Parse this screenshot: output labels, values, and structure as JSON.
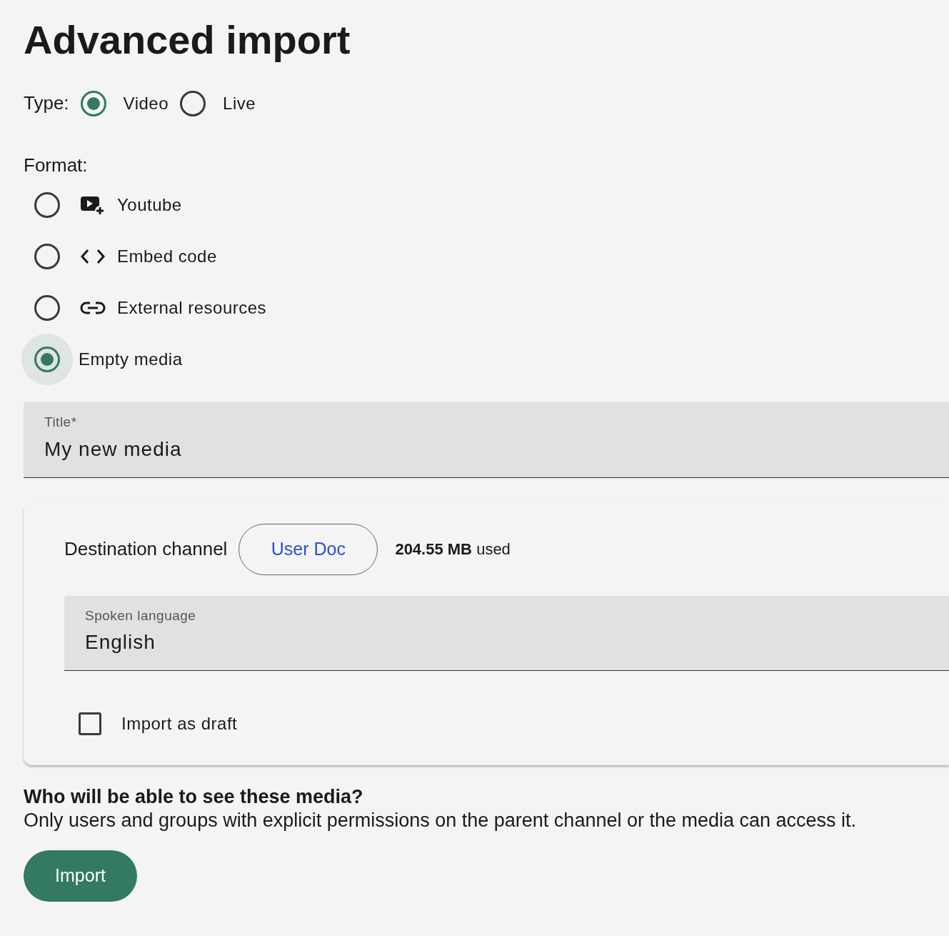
{
  "page": {
    "title": "Advanced import"
  },
  "type": {
    "label": "Type:",
    "options": [
      {
        "label": "Video",
        "selected": true
      },
      {
        "label": "Live",
        "selected": false
      }
    ]
  },
  "format": {
    "label": "Format:",
    "options": [
      {
        "kind": "youtube",
        "label": "Youtube",
        "selected": false,
        "focused": false
      },
      {
        "kind": "embed",
        "label": "Embed code",
        "selected": false,
        "focused": false
      },
      {
        "kind": "link",
        "label": "External resources",
        "selected": false,
        "focused": false
      },
      {
        "kind": "plain",
        "label": "Empty media",
        "selected": true,
        "focused": true
      }
    ]
  },
  "title_field": {
    "label": "Title",
    "required_mark": "*",
    "value": "My new media"
  },
  "destination": {
    "label": "Destination channel",
    "channel": "User Doc",
    "usage_amount": "204.55 MB",
    "usage_suffix": "used",
    "language_field": {
      "label": "Spoken language",
      "value": "English"
    },
    "draft": {
      "label": "Import as draft",
      "checked": false
    }
  },
  "visibility": {
    "heading": "Who will be able to see these media?",
    "text": "Only users and groups with explicit permissions on the parent channel or the media can access it."
  },
  "submit": {
    "label": "Import"
  }
}
